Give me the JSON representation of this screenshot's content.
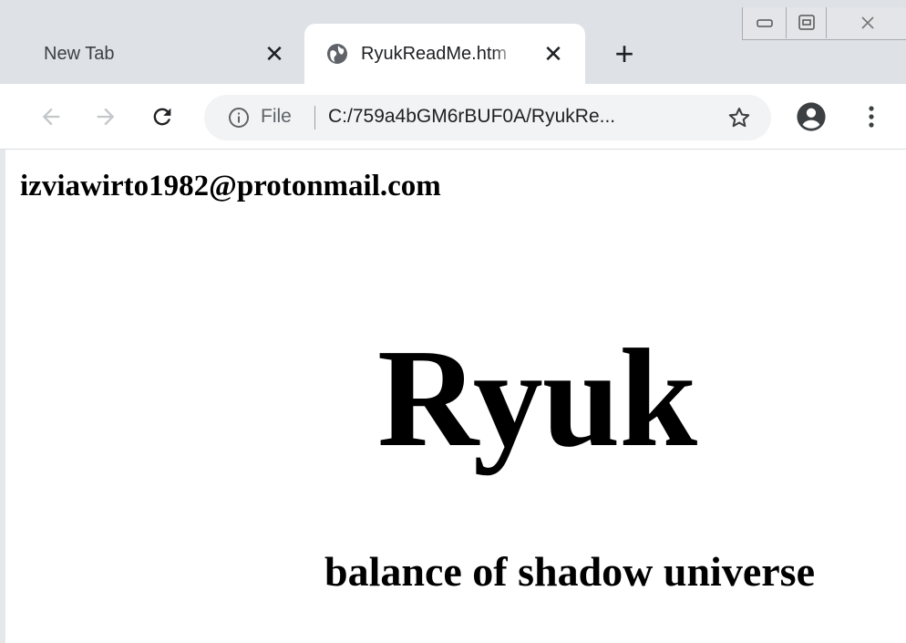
{
  "tabs": [
    {
      "title": "New Tab",
      "active": false
    },
    {
      "title": "RyukReadMe.htm",
      "active": true
    }
  ],
  "toolbar": {
    "scheme_label": "File",
    "url": "C:/759a4bGM6rBUF0A/RyukRe..."
  },
  "icons": {
    "tab_close": "close-icon",
    "favicon": "globe-icon",
    "new_tab": "plus-icon",
    "back": "arrow-left-icon",
    "forward": "arrow-right-icon",
    "reload": "reload-icon",
    "site_info": "info-icon",
    "bookmark": "star-icon",
    "profile": "account-circle-icon",
    "menu": "more-vert-icon"
  },
  "glyphs": {
    "close": "✕",
    "plus": "+"
  },
  "page": {
    "email": "izviawirto1982@protonmail.com",
    "title": "Ryuk",
    "subtitle": "balance of shadow universe"
  },
  "colors": {
    "tabstrip": "#dee1e6",
    "omnibox": "#f1f3f4",
    "text": "#000000",
    "chrome_icon": "#5f6368"
  }
}
